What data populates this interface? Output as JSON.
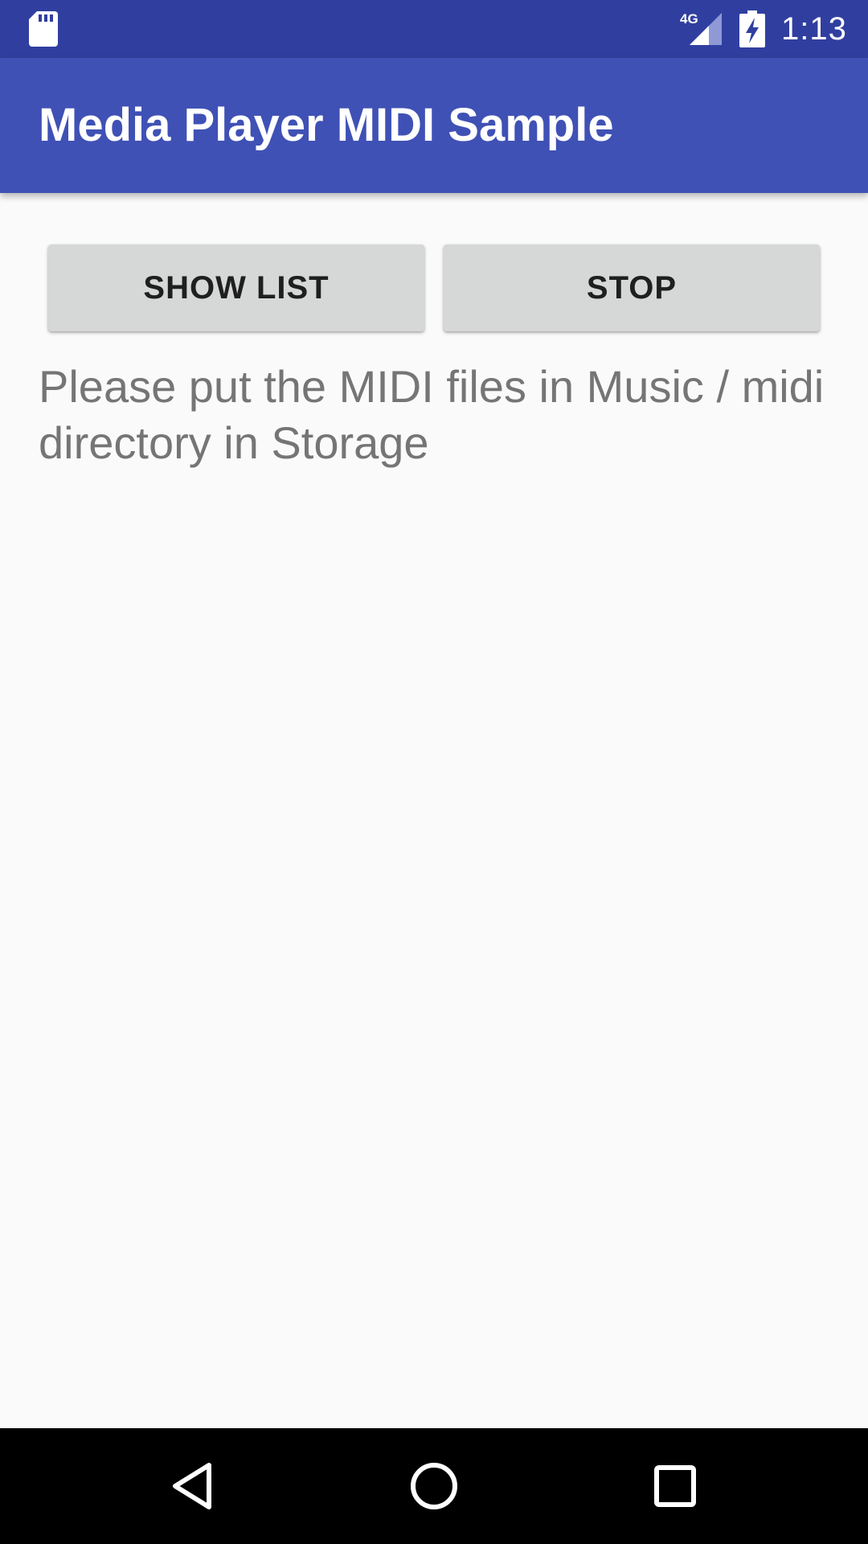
{
  "status_bar": {
    "time": "1:13",
    "network_label": "4G",
    "icons": [
      "sd-card-icon",
      "signal-4g-icon",
      "battery-charging-icon"
    ]
  },
  "app_bar": {
    "title": "Media Player MIDI Sample"
  },
  "actions": {
    "show_list_label": "SHOW LIST",
    "stop_label": "STOP"
  },
  "message": {
    "text": "Please put the MIDI files in Music / midi directory in Storage"
  },
  "nav_bar": {
    "icons": [
      "back-icon",
      "home-icon",
      "recents-icon"
    ]
  },
  "colors": {
    "status_bar": "#303f9f",
    "app_bar": "#3f51b5",
    "background": "#fafafa",
    "button": "#d6d7d7",
    "hint_text": "#757575"
  }
}
